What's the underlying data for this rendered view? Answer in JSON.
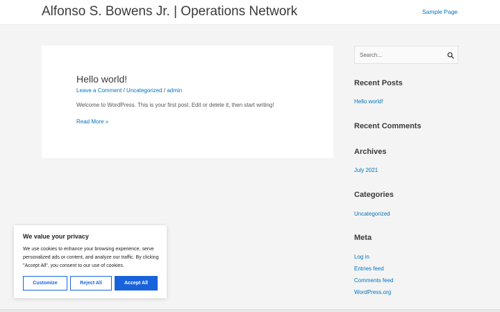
{
  "header": {
    "site_title": "Alfonso S. Bowens Jr. | Operations Network",
    "nav": [
      {
        "label": "Sample Page"
      }
    ]
  },
  "post": {
    "title": "Hello world!",
    "meta": {
      "comment_link": "Leave a Comment",
      "separator": " / ",
      "category": "Uncategorized",
      "author": "admin"
    },
    "excerpt": "Welcome to WordPress. This is your first post. Edit or delete it, then start writing!",
    "read_more": "Read More »"
  },
  "sidebar": {
    "search": {
      "placeholder": "Search...",
      "icon": "search-icon"
    },
    "recent_posts": {
      "title": "Recent Posts",
      "items": [
        "Hello world!"
      ]
    },
    "recent_comments": {
      "title": "Recent Comments"
    },
    "archives": {
      "title": "Archives",
      "items": [
        "July 2021"
      ]
    },
    "categories": {
      "title": "Categories",
      "items": [
        "Uncategorized"
      ]
    },
    "meta": {
      "title": "Meta",
      "items": [
        "Log in",
        "Entries feed",
        "Comments feed",
        "WordPress.org"
      ]
    }
  },
  "cookie": {
    "title": "We value your privacy",
    "text": "We use cookies to enhance your browsing experience, serve personalized ads or content, and analyze our traffic. By clicking \"Accept All\", you consent to our use of cookies.",
    "customize_label": "Customize",
    "reject_label": "Reject All",
    "accept_label": "Accept All"
  },
  "colors": {
    "link": "#0274be",
    "text": "#3a3a3a",
    "background": "#f4f4f4",
    "cookie_accent": "#1863dc"
  }
}
